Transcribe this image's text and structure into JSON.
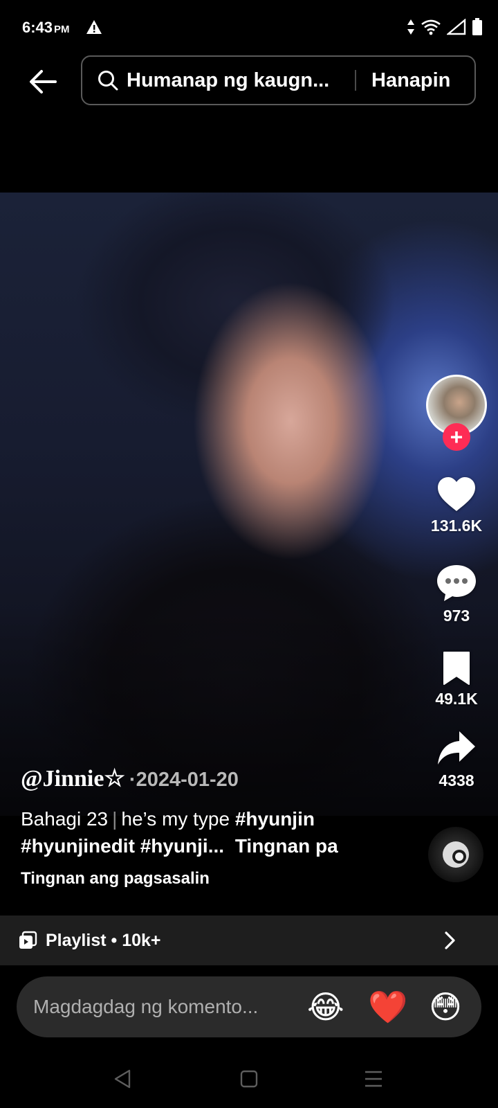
{
  "status_bar": {
    "time": "6:43",
    "ampm": "PM",
    "icons": [
      "warning-icon",
      "data-arrows-icon",
      "wifi-icon",
      "signal-icon",
      "battery-icon"
    ]
  },
  "header": {
    "back_icon": "arrow-left-icon",
    "search_placeholder": "Humanap ng kaugnay na nilalaman",
    "search_value": "Humanap ng kaugn...",
    "search_button": "Hanapin"
  },
  "post": {
    "author": "@Jinnie☆",
    "date_separator": " · ",
    "date": "2024-01-20",
    "caption_part": "Bahagi 23",
    "caption_separator": "|",
    "caption_text": "he’s my type",
    "hashtags": [
      "#hyunjin",
      "#hyunjinedit",
      "#hyunji..."
    ],
    "see_more": "Tingnan pa",
    "translate": "Tingnan ang pagsasalin"
  },
  "actions": {
    "follow_symbol": "+",
    "likes": "131.6K",
    "comments": "973",
    "saves": "49.1K",
    "shares": "4338",
    "like_color": "#ffffff",
    "follow_color": "#fe2c55"
  },
  "playlist": {
    "label": "Playlist • 10k+"
  },
  "comment_bar": {
    "placeholder": "Magdagdag ng komento...",
    "emojis": [
      "😂",
      "❤️",
      "😳"
    ]
  },
  "nav_bar": {
    "items": [
      "back-icon",
      "home-icon",
      "recents-icon"
    ]
  }
}
